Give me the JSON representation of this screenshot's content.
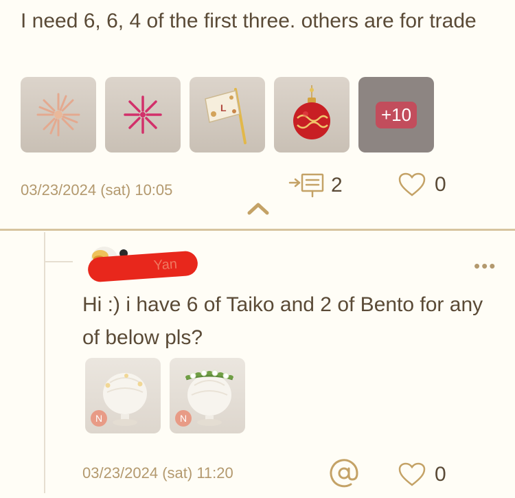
{
  "post": {
    "text": "I need 6, 6, 4 of the first three. others are for trade",
    "items": [
      {
        "icon": "firework-pale-icon"
      },
      {
        "icon": "firework-pink-icon"
      },
      {
        "icon": "flag-icon"
      },
      {
        "icon": "ornament-icon"
      }
    ],
    "more_label": "+10",
    "date": "03/23/2024 (sat) 10:05",
    "reply_count": "2",
    "like_count": "0"
  },
  "reply": {
    "username_fragment": "Yan",
    "text": "Hi :) i have 6 of Taiko and 2 of Bento for any of below pls?",
    "items": [
      {
        "badge": "N"
      },
      {
        "badge": "N"
      }
    ],
    "date": "03/23/2024 (sat) 11:20",
    "like_count": "0"
  },
  "colors": {
    "background": "#fffdf6",
    "text": "#5a4a36",
    "meta": "#b3996e",
    "divider": "#d7c49f",
    "redaction": "#e8271c"
  }
}
